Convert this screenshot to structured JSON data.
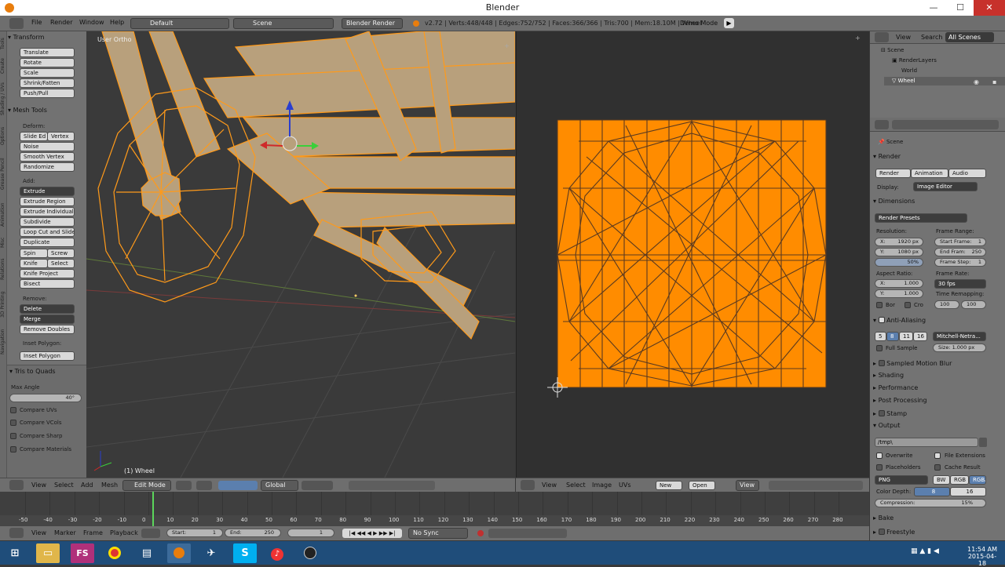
{
  "window": {
    "title": "Blender",
    "minimize": "—",
    "maximize": "☐",
    "close": "✕"
  },
  "info_header": {
    "menus": [
      "File",
      "Render",
      "Window",
      "Help"
    ],
    "layout": "Default",
    "scene": "Scene",
    "engine": "Blender Render",
    "stats": "v2.72 | Verts:448/448 | Edges:752/752 | Faces:366/366 | Tris:700 | Mem:18.10M | Wheel",
    "demo_mode": "Demo Mode"
  },
  "tool_shelf": {
    "tabs": [
      "Tools",
      "Create",
      "Shading / UVs",
      "Options",
      "Grease Pencil",
      "Animation",
      "Misc",
      "Relations",
      "3D Printing",
      "Navigation"
    ],
    "transform": {
      "title": "Transform",
      "buttons": [
        "Translate",
        "Rotate",
        "Scale",
        "Shrink/Fatten",
        "Push/Pull"
      ]
    },
    "mesh_tools": {
      "title": "Mesh Tools",
      "deform_label": "Deform:",
      "slide_edge": "Slide Ed",
      "vertex": "Vertex",
      "noise": "Noise",
      "smooth_vertex": "Smooth Vertex",
      "randomize": "Randomize",
      "add_label": "Add:",
      "extrude": "Extrude",
      "extrude_region": "Extrude Region",
      "extrude_individual": "Extrude Individual",
      "subdivide": "Subdivide",
      "loop_cut": "Loop Cut and Slide",
      "duplicate": "Duplicate",
      "spin": "Spin",
      "screw": "Screw",
      "knife": "Knife",
      "select": "Select",
      "knife_project": "Knife Project",
      "bisect": "Bisect",
      "remove_label": "Remove:",
      "delete": "Delete",
      "merge": "Merge",
      "remove_doubles": "Remove Doubles",
      "inset_label": "Inset Polygon:",
      "inset_button": "Inset Polygon"
    },
    "tris_to_quads": {
      "title": "Tris to Quads",
      "max_angle_label": "Max Angle",
      "max_angle": "40°",
      "options": [
        "Compare UVs",
        "Compare VCols",
        "Compare Sharp",
        "Compare Materials"
      ]
    }
  },
  "viewport": {
    "view_label": "User Ortho",
    "object_label": "(1) Wheel"
  },
  "viewport_header": {
    "menus": [
      "View",
      "Select",
      "Add",
      "Mesh"
    ],
    "mode": "Edit Mode",
    "orientation": "Global"
  },
  "uv_header": {
    "menus": [
      "View",
      "Select",
      "Image",
      "UVs"
    ],
    "new": "New",
    "open": "Open",
    "view": "View"
  },
  "timeline": {
    "ticks": [
      "-50",
      "-40",
      "-30",
      "-20",
      "-10",
      "0",
      "10",
      "20",
      "30",
      "40",
      "50",
      "60",
      "70",
      "80",
      "90",
      "100",
      "110",
      "120",
      "130",
      "140",
      "150",
      "160",
      "170",
      "180",
      "190",
      "200",
      "210",
      "220",
      "230",
      "240",
      "250",
      "260",
      "270",
      "280"
    ],
    "menus": [
      "View",
      "Marker",
      "Frame",
      "Playback"
    ],
    "start": "Start:",
    "start_value": "1",
    "end": "End:",
    "end_value": "250",
    "current": "1",
    "sync": "No Sync"
  },
  "outliner": {
    "menus": [
      "View",
      "Search"
    ],
    "filter": "All Scenes",
    "items": [
      "Scene",
      "RenderLayers",
      "World",
      "Wheel"
    ]
  },
  "properties": {
    "scene_label": "Scene",
    "render": {
      "title": "Render",
      "buttons": [
        "Render",
        "Animation",
        "Audio"
      ],
      "display_label": "Display:",
      "display": "Image Editor"
    },
    "dimensions": {
      "title": "Dimensions",
      "presets": "Render Presets",
      "resolution_label": "Resolution:",
      "res_x_label": "X:",
      "res_x": "1920 px",
      "res_y_label": "Y:",
      "res_y": "1080 px",
      "res_pct": "50%",
      "frame_range_label": "Frame Range:",
      "start_frame": "Start Frame:",
      "start_frame_val": "1",
      "end_frame": "End Fram:",
      "end_frame_val": "250",
      "frame_step": "Frame Step:",
      "frame_step_val": "1",
      "aspect_label": "Aspect Ratio:",
      "asp_x": "1.000",
      "asp_y": "1.000",
      "frame_rate_label": "Frame Rate:",
      "fps": "30 fps",
      "time_remap_label": "Time Remapping:",
      "remap_old": "100",
      "remap_new": "100",
      "border": "Bor",
      "crop": "Cro"
    },
    "anti_aliasing": {
      "title": "Anti-Aliasing",
      "samples": [
        "5",
        "8",
        "11",
        "16"
      ],
      "filter": "Mitchell-Netra...",
      "full_sample": "Full Sample",
      "size": "Size: 1.000 px"
    },
    "sampled_motion_blur": "Sampled Motion Blur",
    "shading": "Shading",
    "performance": "Performance",
    "post_processing": "Post Processing",
    "stamp": "Stamp",
    "output": {
      "title": "Output",
      "path": "/tmp\\",
      "overwrite": "Overwrite",
      "file_extensions": "File Extensions",
      "placeholders": "Placeholders",
      "cache_result": "Cache Result",
      "format": "PNG",
      "bw": "BW",
      "rgb": "RGB",
      "rgba": "RGBA",
      "color_depth_label": "Color Depth:",
      "depth_8": "8",
      "depth_16": "16",
      "compression": "Compression:",
      "compression_val": "15%"
    },
    "bake": "Bake",
    "freestyle": "Freestyle"
  },
  "taskbar": {
    "apps": [
      "FS"
    ],
    "time": "11:54 AM",
    "date": "2015-04-18"
  },
  "colors": {
    "uv_orange": "#ff8c00",
    "mesh_wood": "#b8a07c",
    "selection": "#ff9a1a",
    "taskbar": "#1f4d7a"
  }
}
